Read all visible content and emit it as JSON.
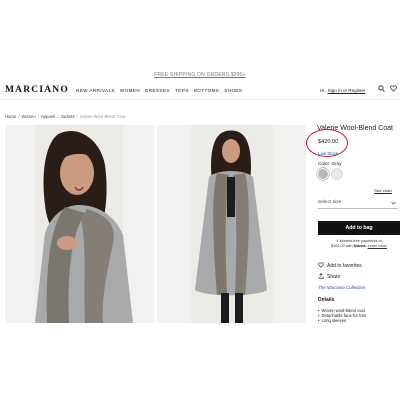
{
  "promo": "FREE SHIPPING ON ORDERS $200+",
  "header": {
    "logo": "MARCIANO",
    "nav": [
      "NEW ARRIVALS",
      "WOMEN",
      "DRESSES",
      "TOPS",
      "BOTTOMS",
      "SHOES"
    ],
    "greeting": "Hi,",
    "sign_in": "Sign in or Register",
    "icons": [
      "search-icon",
      "heart-icon"
    ]
  },
  "breadcrumb": [
    "Home",
    "Women",
    "Apparel",
    "Jackets",
    "Valerie Wool-Blend Coat"
  ],
  "product": {
    "title": "Valerie Wool-Blend Coat",
    "price": "$420.00",
    "stock": "Low Stock",
    "color_label": "Color: Gray",
    "swatches": [
      "#b9b9bb",
      "#ecebdf"
    ],
    "size_chart": "Size chart",
    "select_size": "Select size",
    "add_to_bag": "Add to bag",
    "klarna_line1": "4 interest-free payments of",
    "klarna_amount": "$105.00 with",
    "klarna_brand": "Klarna.",
    "klarna_learn": "Learn more",
    "favorites": "Add to favorites",
    "share": "Share",
    "collection": "The Marciano Collection",
    "details_heading": "Details",
    "details": [
      "Woven wool-blend coat",
      "Detachable faux-fur trim",
      "Long sleeves"
    ]
  },
  "colors": {
    "accent": "#c8102e",
    "link": "#2a4a9a",
    "button": "#111111"
  }
}
